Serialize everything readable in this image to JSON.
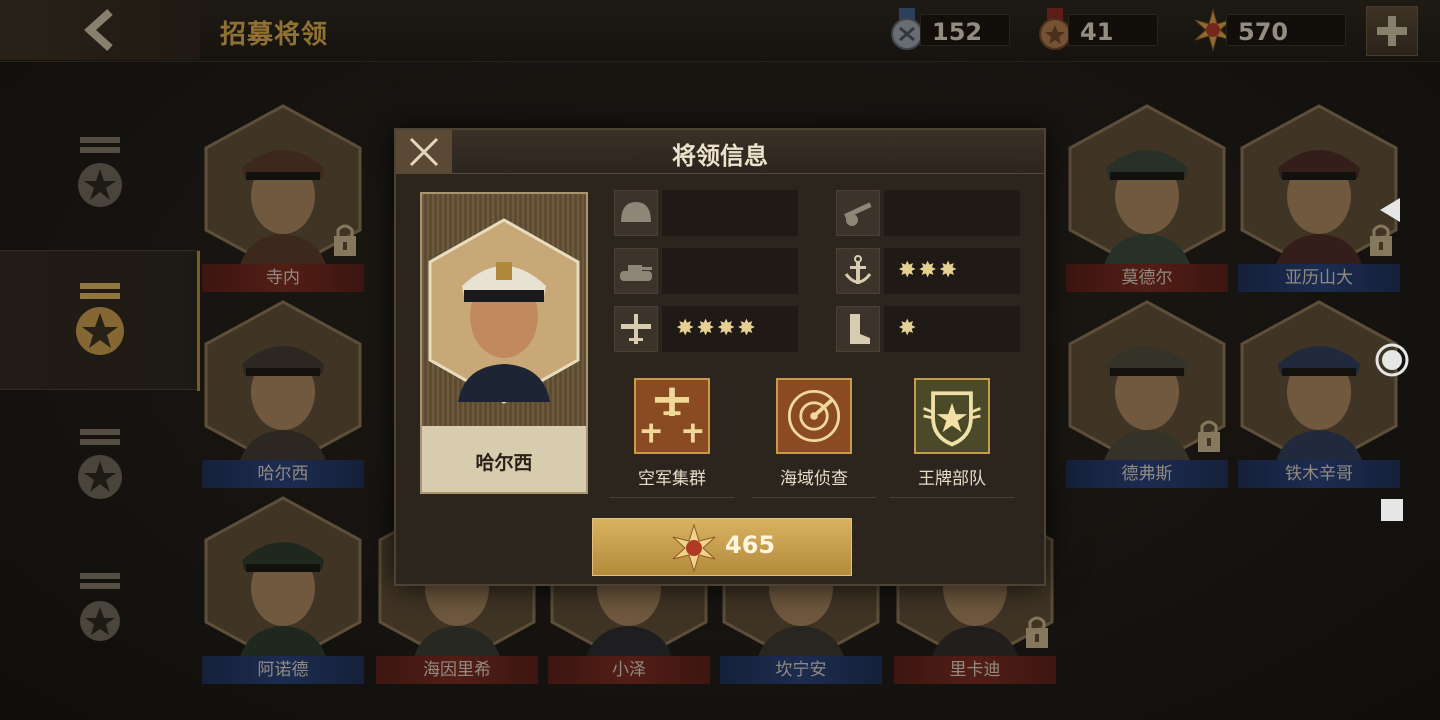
{
  "header": {
    "title": "招募将领",
    "currencies": [
      {
        "icon": "silver-medal-icon",
        "value": "152"
      },
      {
        "icon": "bronze-medal-icon",
        "value": "41"
      },
      {
        "icon": "gold-star-medal-icon",
        "value": "570"
      }
    ],
    "add_icon": "plus-icon"
  },
  "sidebar": {
    "tabs": [
      {
        "icon": "rank-insignia-1-icon",
        "active": false
      },
      {
        "icon": "rank-insignia-2-icon",
        "active": true
      },
      {
        "icon": "rank-insignia-3-icon",
        "active": false
      },
      {
        "icon": "rank-insignia-4-icon",
        "active": false
      }
    ]
  },
  "generals": [
    {
      "name": "寺内",
      "faction": "red",
      "locked": true
    },
    {
      "name": "莫德尔",
      "faction": "red",
      "locked": false
    },
    {
      "name": "亚历山大",
      "faction": "blue",
      "locked": true
    },
    {
      "name": "哈尔西",
      "faction": "blue",
      "locked": false
    },
    {
      "name": "德弗斯",
      "faction": "blue",
      "locked": true
    },
    {
      "name": "铁木辛哥",
      "faction": "blue",
      "locked": false
    },
    {
      "name": "阿诺德",
      "faction": "blue",
      "locked": false
    },
    {
      "name": "海因里希",
      "faction": "red",
      "locked": false
    },
    {
      "name": "小泽",
      "faction": "red",
      "locked": false
    },
    {
      "name": "坎宁安",
      "faction": "blue",
      "locked": false
    },
    {
      "name": "里卡迪",
      "faction": "red",
      "locked": true
    }
  ],
  "modal": {
    "title": "将领信息",
    "close_icon": "close-icon",
    "general_name": "哈尔西",
    "stats": [
      {
        "icon": "helmet-icon",
        "stars": ""
      },
      {
        "icon": "artillery-icon",
        "stars": ""
      },
      {
        "icon": "tank-icon",
        "stars": ""
      },
      {
        "icon": "anchor-icon",
        "stars": "✸✸✸"
      },
      {
        "icon": "airplane-icon",
        "stars": "✸✸✸✸"
      },
      {
        "icon": "boot-icon",
        "stars": "✸"
      }
    ],
    "skills": [
      {
        "label": "空军集群",
        "icon": "air-group-icon"
      },
      {
        "label": "海域侦查",
        "icon": "radar-icon"
      },
      {
        "label": "王牌部队",
        "icon": "ace-badge-icon"
      }
    ],
    "cost": "465",
    "cost_icon": "gold-star-medal-icon"
  },
  "colors": {
    "accent": "#d9a94a",
    "red_faction": "#7a2a20",
    "blue_faction": "#27407a"
  }
}
